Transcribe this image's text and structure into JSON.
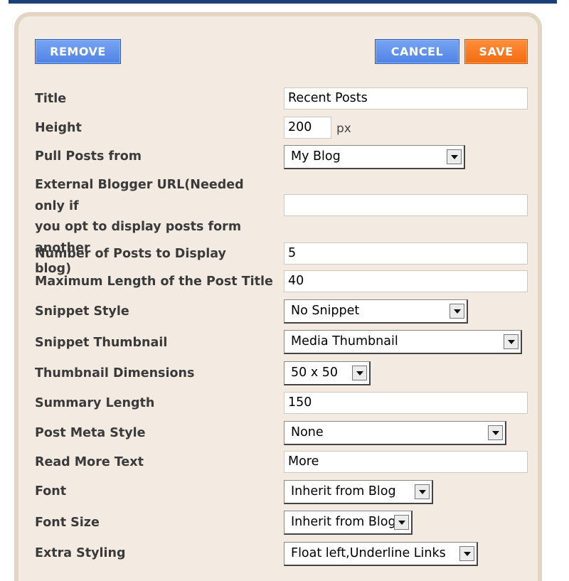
{
  "buttons": {
    "remove": "REMOVE",
    "cancel": "CANCEL",
    "save": "SAVE"
  },
  "fields": {
    "title": {
      "label": "Title",
      "value": "Recent Posts"
    },
    "height": {
      "label": "Height",
      "value": "200",
      "unit": "px"
    },
    "pull_posts": {
      "label": "Pull Posts from",
      "value": "My Blog"
    },
    "external_url": {
      "label_lines": [
        "External Blogger URL(Needed only if",
        "you opt to display posts form another",
        "blog)"
      ],
      "value": ""
    },
    "num_posts": {
      "label": "Number of Posts to Display",
      "value": "5"
    },
    "max_title_length": {
      "label": "Maximum Length of the Post Title",
      "value": "40"
    },
    "snippet_style": {
      "label": "Snippet Style",
      "value": "No Snippet"
    },
    "snippet_thumbnail": {
      "label": "Snippet Thumbnail",
      "value": "Media Thumbnail"
    },
    "thumbnail_dimensions": {
      "label": "Thumbnail Dimensions",
      "value": "50 x 50"
    },
    "summary_length": {
      "label": "Summary Length",
      "value": "150"
    },
    "post_meta_style": {
      "label": "Post Meta Style",
      "value": "None"
    },
    "read_more_text": {
      "label": "Read More Text",
      "value": "More"
    },
    "font": {
      "label": "Font",
      "value": "Inherit from Blog"
    },
    "font_size": {
      "label": "Font Size",
      "value": "Inherit from Blog"
    },
    "extra_styling": {
      "label": "Extra Styling",
      "value": "Float left,Underline Links"
    }
  },
  "colors": {
    "panel_bg": "#f3ebe2",
    "panel_border": "#e2d5c3",
    "blue_button": "#5b8ee8",
    "orange_button": "#f57a1f",
    "top_bar": "#1c3f78"
  }
}
